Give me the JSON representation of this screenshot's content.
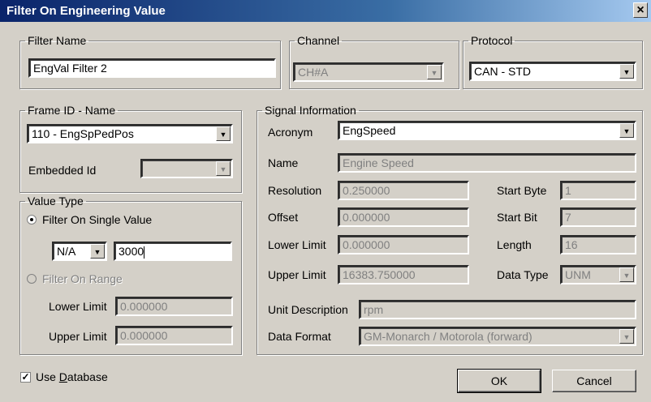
{
  "window": {
    "title": "Filter On Engineering Value",
    "close_glyph": "×"
  },
  "filter_name": {
    "legend": "Filter Name",
    "value": "EngVal Filter 2"
  },
  "channel": {
    "legend": "Channel",
    "value": "CH#A"
  },
  "protocol": {
    "legend": "Protocol",
    "value": "CAN - STD"
  },
  "frame": {
    "legend": "Frame ID - Name",
    "value": "110 - EngSpPedPos",
    "embedded_label": "Embedded Id",
    "embedded_value": ""
  },
  "value_type": {
    "legend": "Value Type",
    "single_label": "Filter On Single Value",
    "single_checked": true,
    "operator": "N/A",
    "single_value": "3000",
    "range_label": "Filter On Range",
    "range_checked": false,
    "lower_label": "Lower Limit",
    "lower_value": "0.000000",
    "upper_label": "Upper Limit",
    "upper_value": "0.000000"
  },
  "signal": {
    "legend": "Signal Information",
    "acronym_label": "Acronym",
    "acronym_value": "EngSpeed",
    "name_label": "Name",
    "name_value": "Engine Speed",
    "resolution_label": "Resolution",
    "resolution_value": "0.250000",
    "offset_label": "Offset",
    "offset_value": "0.000000",
    "lower_label": "Lower Limit",
    "lower_value": "0.000000",
    "upper_label": "Upper Limit",
    "upper_value": "16383.750000",
    "start_byte_label": "Start Byte",
    "start_byte_value": "1",
    "start_bit_label": "Start Bit",
    "start_bit_value": "7",
    "length_label": "Length",
    "length_value": "16",
    "data_type_label": "Data Type",
    "data_type_value": "UNM",
    "unit_label": "Unit Description",
    "unit_value": "rpm",
    "format_label": "Data Format",
    "format_value": "GM-Monarch / Motorola (forward)"
  },
  "use_database": {
    "label": "Use Database",
    "underline": "D",
    "checked": true
  },
  "buttons": {
    "ok": "OK",
    "cancel": "Cancel"
  },
  "icons": {
    "dropdown": "dropdown-arrow-icon",
    "check": "checkmark-icon"
  }
}
